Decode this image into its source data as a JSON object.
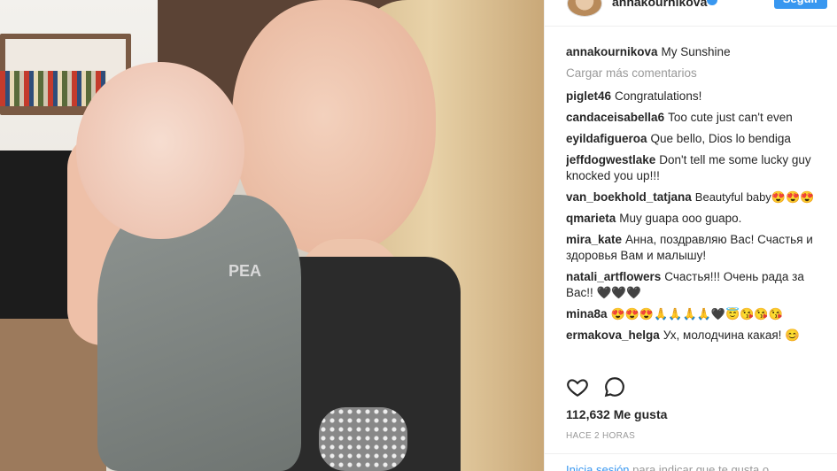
{
  "header": {
    "username": "annakournikova",
    "follow_label": "Seguir"
  },
  "photo": {
    "shirt_text": "PEA"
  },
  "caption": {
    "user": "annakournikova",
    "text": "My Sunshine"
  },
  "load_more_label": "Cargar más comentarios",
  "comments": [
    {
      "user": "piglet46",
      "text": "Congratulations!"
    },
    {
      "user": "candaceisabella6",
      "text": "Too cute just can't even"
    },
    {
      "user": "eyildafigueroa",
      "text": "Que bello, Dios lo bendiga"
    },
    {
      "user": "jeffdogwestlake",
      "text": "Don't tell me some lucky guy knocked you up!!!"
    },
    {
      "user": "van_boekhold_tatjana",
      "text": "Beautyful baby😍😍😍"
    },
    {
      "user": "qmarieta",
      "text": "Muy guapa ooo guapo."
    },
    {
      "user": "mira_kate",
      "text": "Анна, поздравляю Вас! Счастья и здоровья Вам и малышу!"
    },
    {
      "user": "natali_artflowers",
      "text": "Счастья!!! Очень рада за Вас!! 🖤🖤🖤"
    },
    {
      "user": "mina8a",
      "text": "😍😍😍🙏🙏🙏🙏🖤😇😘😘😘"
    },
    {
      "user": "ermakova_helga",
      "text": "Ух, молодчина какая! 😊"
    }
  ],
  "likes_text": "112,632 Me gusta",
  "time_text": "HACE 2 HORAS",
  "login": {
    "link": "Inicia sesión",
    "text": " para indicar que te gusta o"
  },
  "icons": {
    "like": "heart-outline-icon",
    "comment": "speech-bubble-icon",
    "verified": "verified-badge-icon"
  },
  "colors": {
    "accent": "#3897f0",
    "muted": "#999999",
    "text": "#262626"
  }
}
